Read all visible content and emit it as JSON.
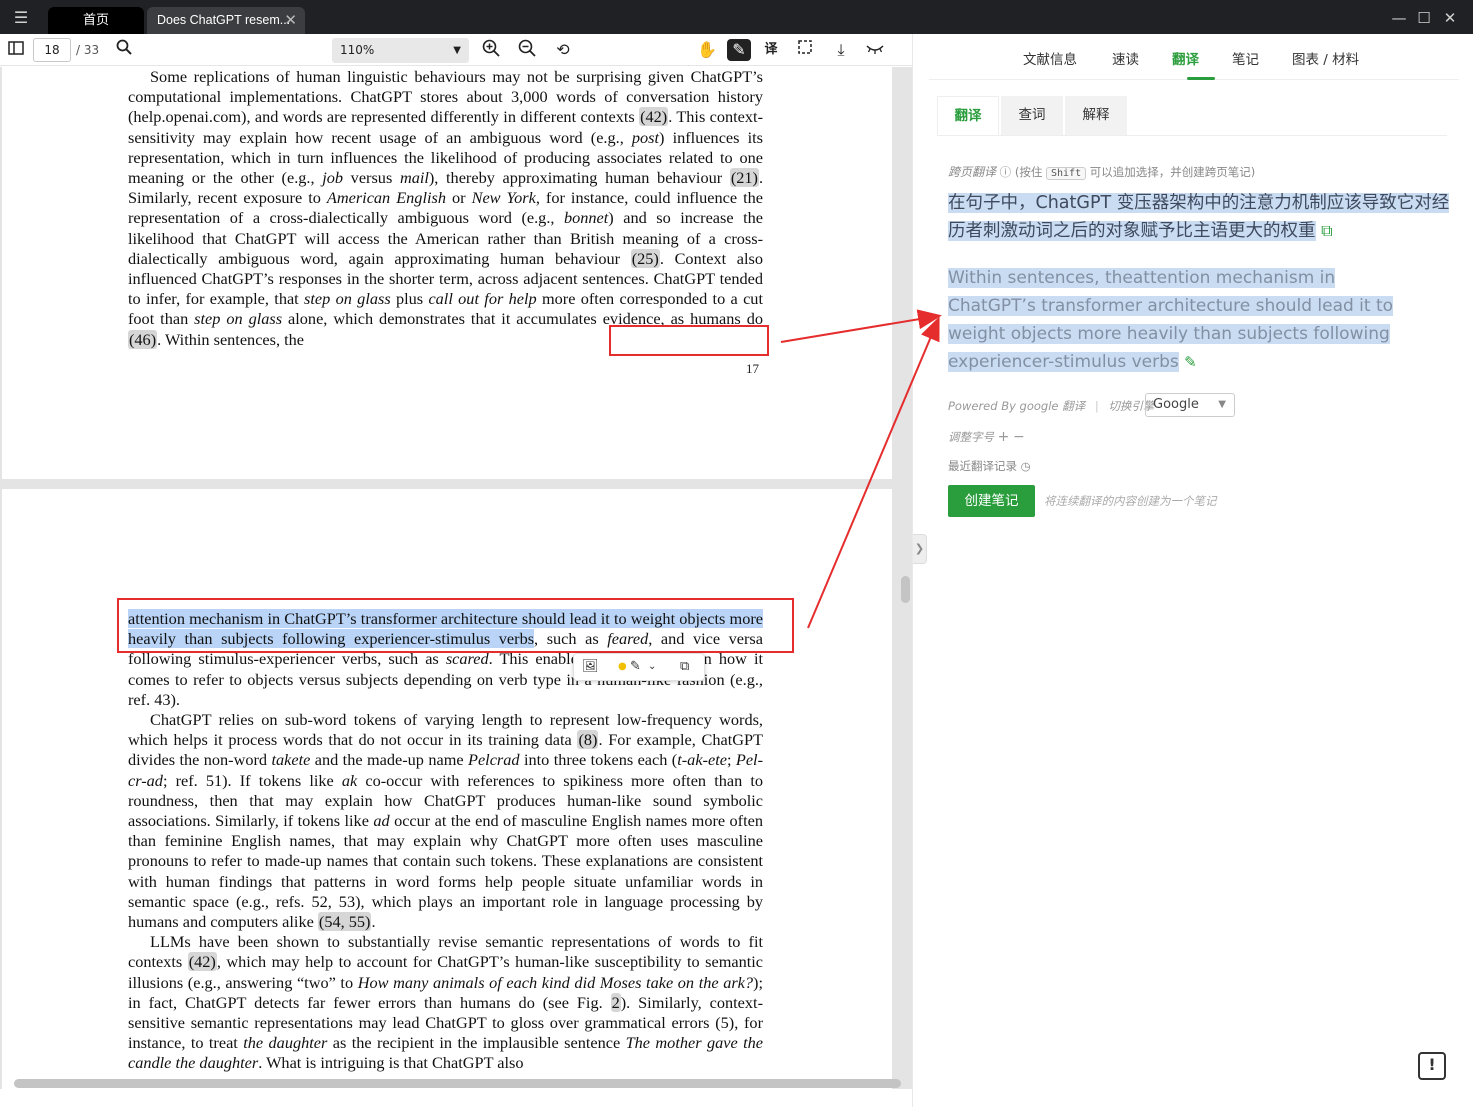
{
  "tabs": {
    "home_label": "首页",
    "doc_label": "Does ChatGPT resem..."
  },
  "toolbar": {
    "page_current": "18",
    "page_total": "/ 33",
    "zoom": "110%"
  },
  "document": {
    "page_a": {
      "paragraph": [
        {
          "t": "Some replications of human linguistic behaviours may not be surprising given ChatGPT’s computational implementations. ChatGPT stores about 3,000 words of conversation history (help.openai.com), and words are represented differently in different contexts "
        },
        {
          "t": "(42)",
          "ref": true
        },
        {
          "t": ". This context-sensitivity may explain how recent usage of an ambiguous word (e.g., "
        },
        {
          "t": "post",
          "i": true
        },
        {
          "t": ") influences its representation, which in turn influences the likelihood of producing associates related to one meaning or the other (e.g., "
        },
        {
          "t": "job",
          "i": true
        },
        {
          "t": " versus "
        },
        {
          "t": "mail",
          "i": true
        },
        {
          "t": "), thereby approximating human behaviour "
        },
        {
          "t": "(21)",
          "ref": true
        },
        {
          "t": ". Similarly, recent exposure to "
        },
        {
          "t": "American English",
          "i": true
        },
        {
          "t": " or "
        },
        {
          "t": "New York",
          "i": true
        },
        {
          "t": ", for instance, could influence the representation of a cross-dialectically ambiguous word (e.g., "
        },
        {
          "t": "bonnet",
          "i": true
        },
        {
          "t": ") and so increase the likelihood that ChatGPT will access the American rather than British meaning of a cross-dialectically ambiguous word, again approximating human behaviour "
        },
        {
          "t": "(25)",
          "ref": true
        },
        {
          "t": ". Context also influenced ChatGPT’s responses in the shorter term, across adjacent sentences. ChatGPT tended to infer, for example, that "
        },
        {
          "t": "step on glass",
          "i": true
        },
        {
          "t": " plus "
        },
        {
          "t": "call out for help",
          "i": true
        },
        {
          "t": " more often corresponded to a cut foot than "
        },
        {
          "t": "step on glass",
          "i": true
        },
        {
          "t": " alone, which demonstrates that it accumulates evidence, as humans do "
        },
        {
          "t": "(46)",
          "ref": true
        },
        {
          "t": ". Within sentences, the"
        }
      ],
      "page_number": "17"
    },
    "page_b": {
      "paragraphs": [
        {
          "noind": true,
          "runs": [
            {
              "t": "attention mechanism in ChatGPT’s transformer architecture should lead it to weight objects more heavily than subjects following experiencer-stimulus verbs",
              "hl": true
            },
            {
              "t": ", such as "
            },
            {
              "t": "feared",
              "i": true
            },
            {
              "t": ", and vice versa following stimulus-experiencer verbs, such as "
            },
            {
              "t": "scared",
              "i": true
            },
            {
              "t": ". This enables ChatGPT to learn how it comes to refer to objects versus subjects depending on verb type in a human-like fashion (e.g., ref. 43)."
            }
          ]
        },
        {
          "runs": [
            {
              "t": "ChatGPT relies on sub-word tokens of varying length to represent low-frequency words, which helps it process words that do not occur in its training data "
            },
            {
              "t": "(8)",
              "ref": true
            },
            {
              "t": ". For example, ChatGPT divides the non-word "
            },
            {
              "t": "takete",
              "i": true
            },
            {
              "t": " and the made-up name "
            },
            {
              "t": "Pelcrad",
              "i": true
            },
            {
              "t": " into three tokens each ("
            },
            {
              "t": "t-ak-ete",
              "i": true
            },
            {
              "t": "; "
            },
            {
              "t": "Pel-cr-ad",
              "i": true
            },
            {
              "t": "; ref. 51). If tokens like "
            },
            {
              "t": "ak",
              "i": true
            },
            {
              "t": " co-occur with references to spikiness more often than to roundness, then that may explain how ChatGPT produces human-like sound symbolic associations. Similarly, if tokens like "
            },
            {
              "t": "ad",
              "i": true
            },
            {
              "t": " occur at the end of masculine English names more often than feminine English names, that may explain why ChatGPT more often uses masculine pronouns to refer to made-up names that contain such tokens. These explanations are consistent with human findings that patterns in word forms help people situate unfamiliar words in semantic space (e.g., refs. 52, 53), which plays an important role in language processing by humans and computers alike "
            },
            {
              "t": "(54, 55)",
              "ref": true
            },
            {
              "t": "."
            }
          ]
        },
        {
          "runs": [
            {
              "t": "LLMs have been shown to substantially revise semantic representations of words to fit contexts "
            },
            {
              "t": "(42)",
              "ref": true
            },
            {
              "t": ", which may help to account for ChatGPT’s human-like susceptibility to semantic illusions (e.g., answering “two” to "
            },
            {
              "t": "How many animals of each kind did Moses take on the ark?",
              "i": true
            },
            {
              "t": "); in fact, ChatGPT detects far fewer errors than humans do (see Fig. "
            },
            {
              "t": "2",
              "ref": true
            },
            {
              "t": "). Similarly, context-sensitive semantic representations may lead ChatGPT to gloss over grammatical errors (5), for instance, to treat "
            },
            {
              "t": "the daughter",
              "i": true
            },
            {
              "t": " as the recipient in the implausible sentence "
            },
            {
              "t": "The mother gave the candle the daughter",
              "i": true
            },
            {
              "t": ". What is intriguing is that ChatGPT also"
            }
          ]
        }
      ]
    }
  },
  "sidebar": {
    "top_tabs": [
      "文献信息",
      "速读",
      "翻译",
      "笔记",
      "图表 / 材料"
    ],
    "sub_tabs": [
      "翻译",
      "查词",
      "解释"
    ],
    "cross_page_label": "跨页翻译",
    "cross_page_hint_pre": "(按住",
    "cross_page_key": "Shift",
    "cross_page_hint_post": "可以追加选择，并创建跨页笔记)",
    "translation": "在句子中，ChatGPT 变压器架构中的注意力机制应该导致它对经历者刺激动词之后的对象赋予比主语更大的权重",
    "source": "Within sentences, theattention mechanism in ChatGPT’s transformer architecture should lead it to weight objects more heavily than subjects following experiencer-stimulus verbs",
    "powered_by": "Powered By google 翻译",
    "engine_label": "切换引擎",
    "engine_value": "Google",
    "font_adjust_label": "调整字号",
    "recent_label": "最近翻译记录",
    "create_note_label": "创建笔记",
    "create_note_hint": "将连续翻译的内容创建为一个笔记"
  }
}
